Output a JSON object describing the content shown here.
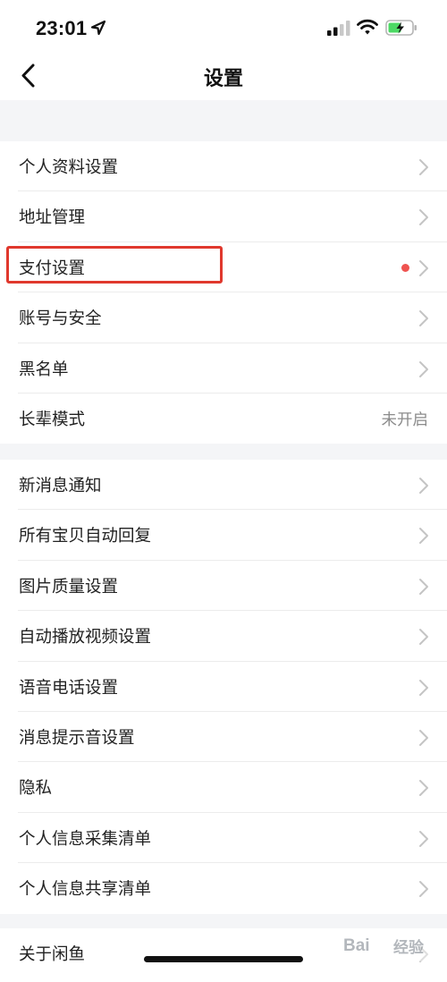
{
  "status_bar": {
    "time": "23:01"
  },
  "header": {
    "title": "设置"
  },
  "group1": [
    {
      "label": "个人资料设置"
    },
    {
      "label": "地址管理"
    },
    {
      "label": "支付设置"
    },
    {
      "label": "账号与安全"
    },
    {
      "label": "黑名单"
    },
    {
      "label": "长辈模式",
      "value": "未开启"
    }
  ],
  "group2": [
    {
      "label": "新消息通知"
    },
    {
      "label": "所有宝贝自动回复"
    },
    {
      "label": "图片质量设置"
    },
    {
      "label": "自动播放视频设置"
    },
    {
      "label": "语音电话设置"
    },
    {
      "label": "消息提示音设置"
    },
    {
      "label": "隐私"
    },
    {
      "label": "个人信息采集清单"
    },
    {
      "label": "个人信息共享清单"
    }
  ],
  "group3": [
    {
      "label": "关于闲鱼"
    }
  ],
  "watermark": {
    "brand": "Bai",
    "sub": "经验"
  },
  "colors": {
    "highlight": "#e0382d",
    "badge_dot": "#ef5350",
    "page_bg": "#f4f5f7"
  }
}
